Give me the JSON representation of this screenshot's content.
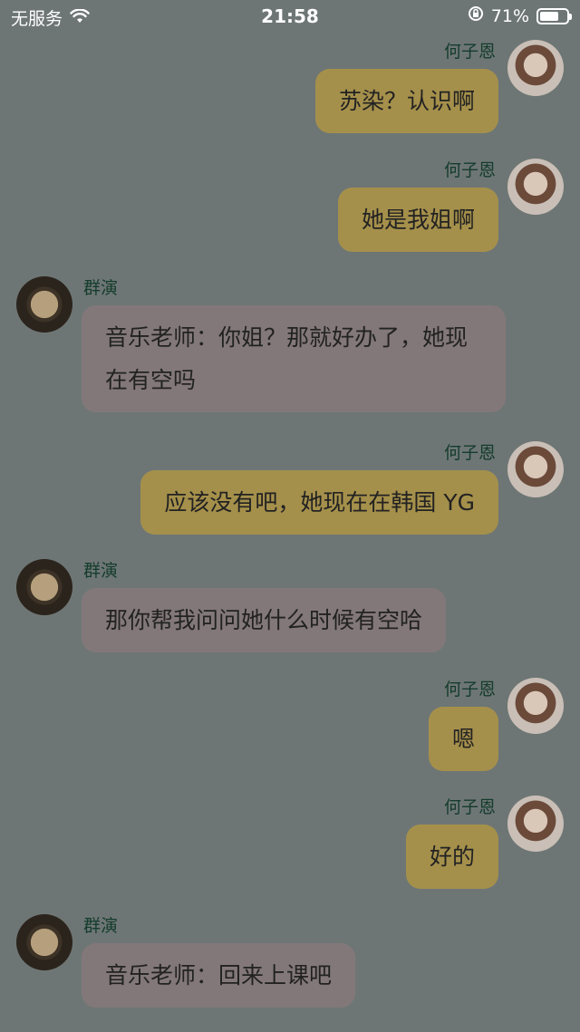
{
  "status_bar": {
    "carrier": "无服务",
    "time": "21:58",
    "battery_percent": "71%",
    "battery_level": 0.71
  },
  "messages": [
    {
      "side": "right",
      "sender": "何子恩",
      "text": "苏染？认识啊"
    },
    {
      "side": "right",
      "sender": "何子恩",
      "text": "她是我姐啊"
    },
    {
      "side": "left",
      "sender": "群演",
      "text": "音乐老师：你姐？那就好办了，她现在有空吗"
    },
    {
      "side": "right",
      "sender": "何子恩",
      "text": "应该没有吧，她现在在韩国 YG"
    },
    {
      "side": "left",
      "sender": "群演",
      "text": "那你帮我问问她什么时候有空哈"
    },
    {
      "side": "right",
      "sender": "何子恩",
      "text": "嗯"
    },
    {
      "side": "right",
      "sender": "何子恩",
      "text": "好的"
    },
    {
      "side": "left",
      "sender": "群演",
      "text": "音乐老师：回来上课吧"
    }
  ],
  "colors": {
    "background": "#6e7675",
    "bubble_right": "#a5904b",
    "bubble_left": "#837879",
    "sender_name": "#143c2c"
  },
  "icons": {
    "wifi": "wifi-icon",
    "rotation_lock": "rotation-lock-icon",
    "battery": "battery-icon"
  }
}
